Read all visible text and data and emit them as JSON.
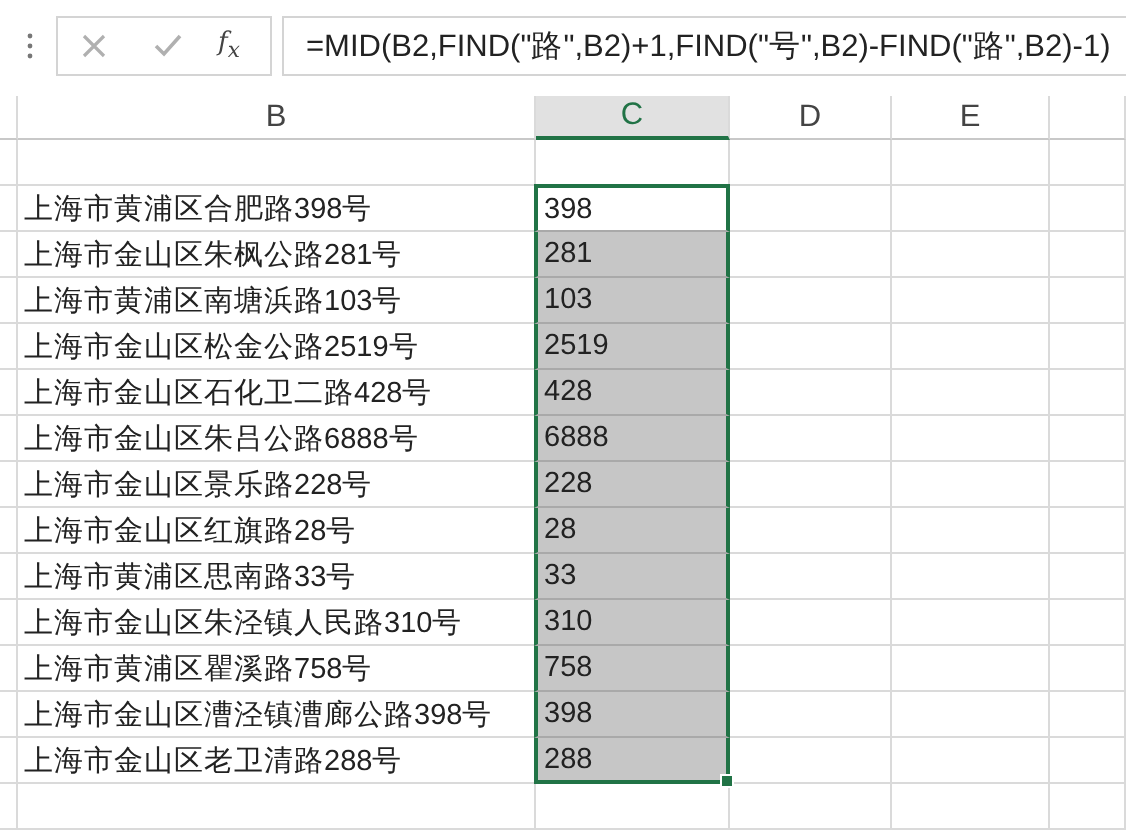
{
  "formula_bar": {
    "function_label": "f$_{x}$",
    "formula": "=MID(B2,FIND(\"路\",B2)+1,FIND(\"号\",B2)-FIND(\"路\",B2)-1)"
  },
  "columns": [
    {
      "label": "B",
      "selected": false
    },
    {
      "label": "C",
      "selected": true
    },
    {
      "label": "D",
      "selected": false
    },
    {
      "label": "E",
      "selected": false
    }
  ],
  "rows": [
    {
      "address": "上海市黄浦区合肥路398号",
      "result": "398",
      "selected": true,
      "active": true
    },
    {
      "address": "上海市金山区朱枫公路281号",
      "result": "281",
      "selected": true,
      "active": false
    },
    {
      "address": "上海市黄浦区南塘浜路103号",
      "result": "103",
      "selected": true,
      "active": false
    },
    {
      "address": "上海市金山区松金公路2519号",
      "result": "2519",
      "selected": true,
      "active": false
    },
    {
      "address": "上海市金山区石化卫二路428号",
      "result": "428",
      "selected": true,
      "active": false
    },
    {
      "address": "上海市金山区朱吕公路6888号",
      "result": "6888",
      "selected": true,
      "active": false
    },
    {
      "address": "上海市金山区景乐路228号",
      "result": "228",
      "selected": true,
      "active": false
    },
    {
      "address": "上海市金山区红旗路28号",
      "result": "28",
      "selected": true,
      "active": false
    },
    {
      "address": "上海市黄浦区思南路33号",
      "result": "33",
      "selected": true,
      "active": false
    },
    {
      "address": "上海市金山区朱泾镇人民路310号",
      "result": "310",
      "selected": true,
      "active": false
    },
    {
      "address": "上海市黄浦区瞿溪路758号",
      "result": "758",
      "selected": true,
      "active": false
    },
    {
      "address": "上海市金山区漕泾镇漕廊公路398号",
      "result": "398",
      "selected": true,
      "active": false
    },
    {
      "address": "上海市金山区老卫清路288号",
      "result": "288",
      "selected": true,
      "active": false
    }
  ]
}
